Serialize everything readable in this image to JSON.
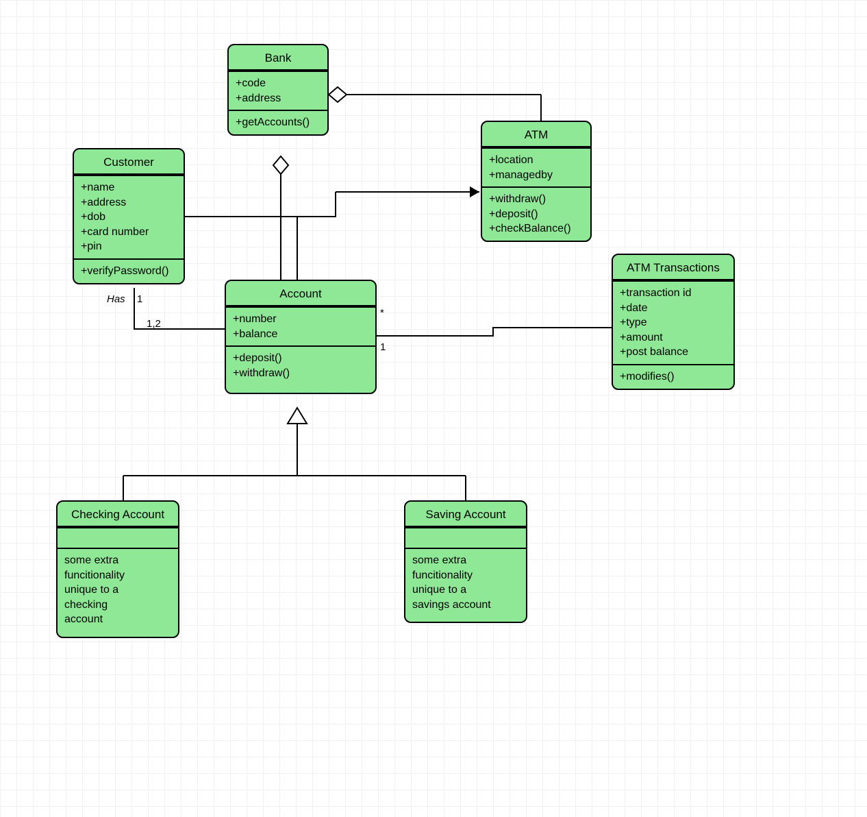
{
  "chart_data": {
    "type": "uml-class-diagram",
    "classes": [
      {
        "id": "bank",
        "name": "Bank",
        "attributes": [
          "+code",
          "+address"
        ],
        "methods": [
          "+getAccounts()"
        ]
      },
      {
        "id": "customer",
        "name": "Customer",
        "attributes": [
          "+name",
          "+address",
          "+dob",
          "+card number",
          "+pin"
        ],
        "methods": [
          "+verifyPassword()"
        ]
      },
      {
        "id": "atm",
        "name": "ATM",
        "attributes": [
          "+location",
          "+managedby"
        ],
        "methods": [
          "+withdraw()",
          "+deposit()",
          "+checkBalance()"
        ]
      },
      {
        "id": "account",
        "name": "Account",
        "attributes": [
          "+number",
          "+balance"
        ],
        "methods": [
          "+deposit()",
          "+withdraw()"
        ]
      },
      {
        "id": "atmtransactions",
        "name": "ATM Transactions",
        "attributes": [
          "+transaction id",
          "+date",
          "+type",
          "+amount",
          "+post balance"
        ],
        "methods": [
          "+modifies()"
        ]
      },
      {
        "id": "checking",
        "name": "Checking Account",
        "attributes": [],
        "methods": [
          "some extra funcitionality unique to a checking account"
        ]
      },
      {
        "id": "saving",
        "name": "Saving Account",
        "attributes": [],
        "methods": [
          "some extra funcitionality unique to a savings account"
        ]
      }
    ],
    "relationships": [
      {
        "from": "bank",
        "to": "atm",
        "type": "aggregation",
        "end": "bank"
      },
      {
        "from": "bank",
        "to": "account",
        "type": "aggregation",
        "end": "bank"
      },
      {
        "from": "customer",
        "to": "account",
        "type": "association",
        "label": "Has",
        "multiplicity": {
          "customer": "1",
          "account": "1,2"
        }
      },
      {
        "from": "account",
        "to": "atm",
        "type": "directed-association",
        "multiplicity": {
          "account": "*"
        }
      },
      {
        "from": "account",
        "to": "atmtransactions",
        "type": "association",
        "multiplicity": {
          "account": "1"
        }
      },
      {
        "from": "checking",
        "to": "account",
        "type": "generalization"
      },
      {
        "from": "saving",
        "to": "account",
        "type": "generalization"
      }
    ]
  },
  "classes": {
    "bank": {
      "title": "Bank",
      "attrs": "+code\n+address",
      "methods": "+getAccounts()"
    },
    "customer": {
      "title": "Customer",
      "attrs": "+name\n+address\n+dob\n+card number\n+pin",
      "methods": "+verifyPassword()"
    },
    "atm": {
      "title": "ATM",
      "attrs": "+location\n+managedby",
      "methods": "+withdraw()\n+deposit()\n+checkBalance()"
    },
    "account": {
      "title": "Account",
      "attrs": "+number\n+balance",
      "methods": "+deposit()\n+withdraw()"
    },
    "atmtransactions": {
      "title": "ATM Transactions",
      "attrs": "+transaction id\n+date\n+type\n+amount\n+post balance",
      "methods": "+modifies()"
    },
    "checking": {
      "title": "Checking Account",
      "attrs": "",
      "methods": "some extra\nfuncitionality\nunique to a\nchecking\naccount"
    },
    "saving": {
      "title": "Saving Account",
      "attrs": "",
      "methods": "some extra\nfuncitionality\nunique to a\nsavings account"
    }
  },
  "labels": {
    "has": "Has",
    "one": "1",
    "onetwo": "1,2",
    "star": "*",
    "one_b": "1"
  }
}
